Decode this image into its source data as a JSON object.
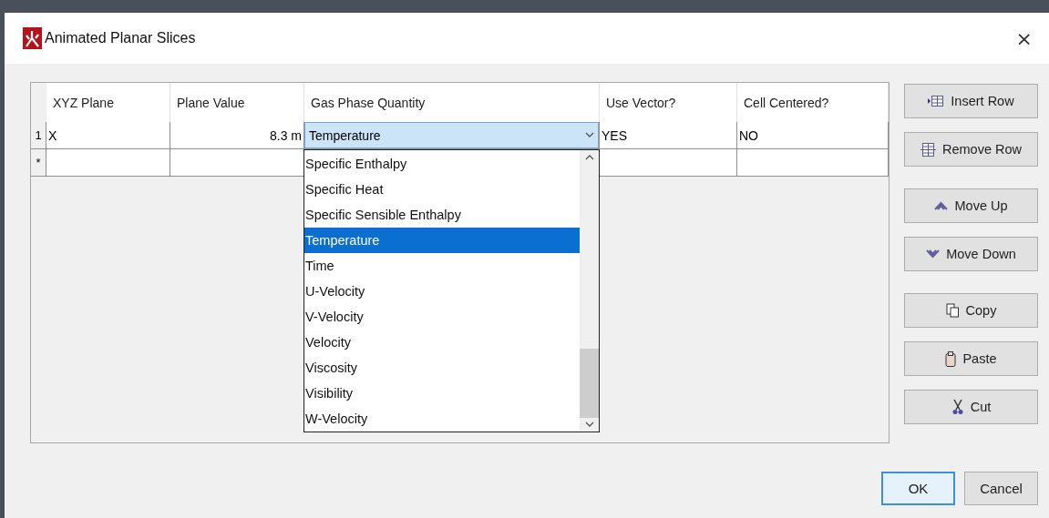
{
  "window": {
    "title": "Animated Planar Slices",
    "close": "×"
  },
  "table": {
    "columns": [
      {
        "label": "XYZ Plane",
        "kind": "text"
      },
      {
        "label": "Plane Value",
        "kind": "number"
      },
      {
        "label": "Gas Phase Quantity",
        "kind": "combo"
      },
      {
        "label": "Use Vector?",
        "kind": "text"
      },
      {
        "label": "Cell Centered?",
        "kind": "text"
      }
    ],
    "rows": [
      {
        "header": "1",
        "cells": [
          "X",
          "8.3 m",
          "Temperature",
          "YES",
          "NO"
        ],
        "dropdown": {
          "items": [
            {
              "label": "Specific Enthalpy",
              "selected": false
            },
            {
              "label": "Specific Heat",
              "selected": false
            },
            {
              "label": "Specific Sensible Enthalpy",
              "selected": false
            },
            {
              "label": "Temperature",
              "selected": true
            },
            {
              "label": "Time",
              "selected": false
            },
            {
              "label": "U-Velocity",
              "selected": false
            },
            {
              "label": "V-Velocity",
              "selected": false
            },
            {
              "label": "Velocity",
              "selected": false
            },
            {
              "label": "Viscosity",
              "selected": false
            },
            {
              "label": "Visibility",
              "selected": false
            },
            {
              "label": "W-Velocity",
              "selected": false
            }
          ]
        }
      },
      {
        "header": "*"
      }
    ]
  },
  "side_button_groups": [
    [
      {
        "label": "Insert Row",
        "kind": "insert"
      },
      {
        "label": "Remove Row",
        "kind": "remove"
      }
    ],
    [
      {
        "label": "Move Up",
        "kind": "up"
      },
      {
        "label": "Move Down",
        "kind": "down"
      }
    ],
    [
      {
        "label": "Copy",
        "kind": "copy"
      },
      {
        "label": "Paste",
        "kind": "paste"
      },
      {
        "label": "Cut",
        "kind": "cut"
      }
    ]
  ],
  "dialog_buttons": [
    {
      "label": "OK",
      "default": true
    },
    {
      "label": "Cancel",
      "default": false
    }
  ]
}
